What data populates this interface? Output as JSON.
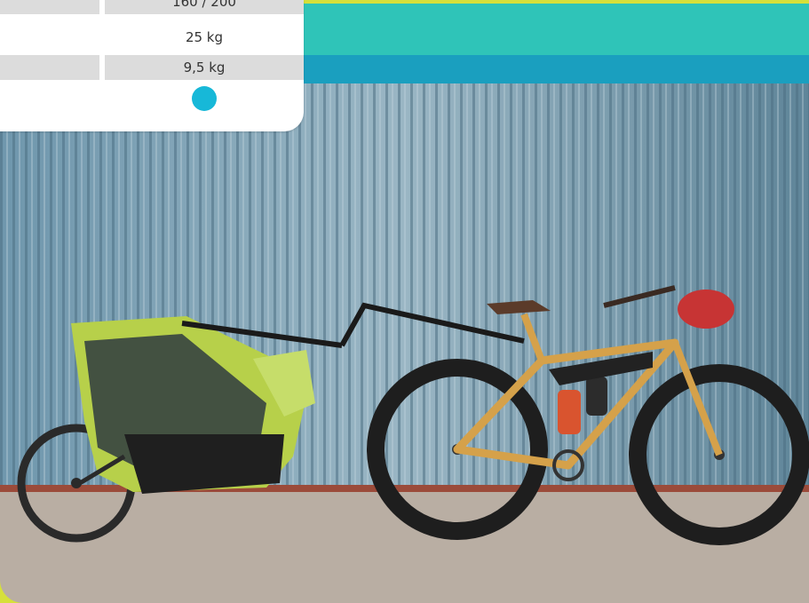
{
  "spec_table": {
    "rows": [
      {
        "label": "",
        "value": "160 / 200",
        "shaded": true
      },
      {
        "label": "",
        "value": "25 kg",
        "shaded": false
      },
      {
        "label": "",
        "value": "9,5 kg",
        "shaded": true
      }
    ],
    "indicator_color": "#17b8d8"
  },
  "colors": {
    "frame": "#d6e03a",
    "band_teal": "#2fc4b8",
    "band_blue": "#1a9fbf"
  },
  "photo": {
    "subject": "bike-with-child-trailer"
  }
}
